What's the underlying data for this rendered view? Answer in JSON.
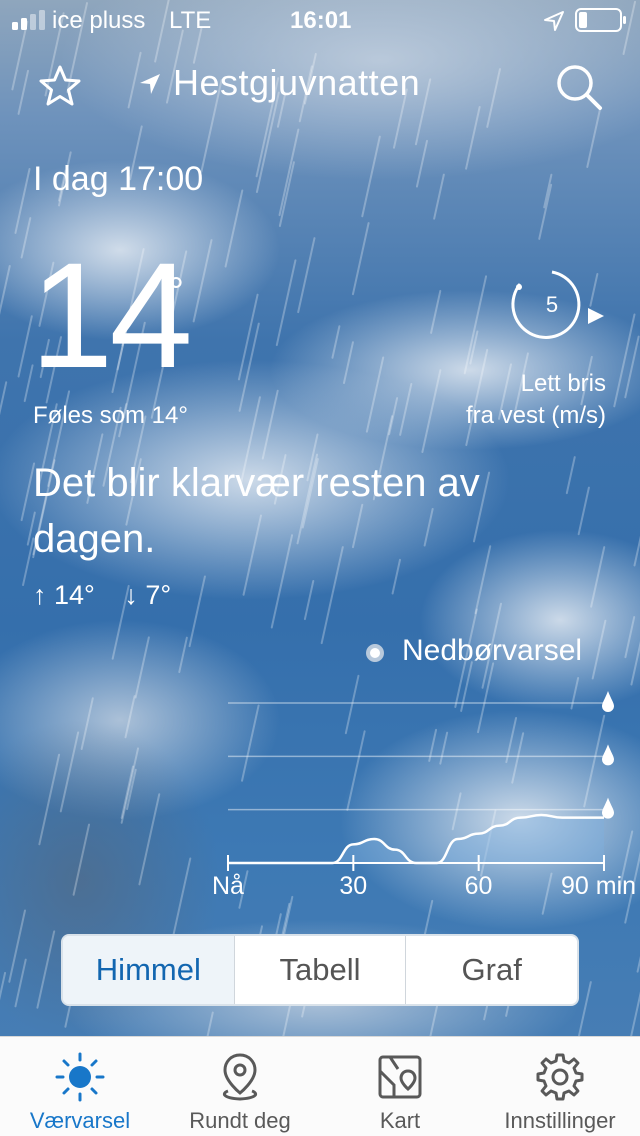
{
  "status_bar": {
    "carrier": "ice pluss",
    "network": "LTE",
    "time": "16:01"
  },
  "header": {
    "location": "Hestgjuvnatten"
  },
  "current": {
    "when": "I dag 17:00",
    "temperature": "14",
    "degree_symbol": "°",
    "feels_like": "Føles som 14°",
    "wind_speed": "5",
    "wind_desc_line1": "Lett bris",
    "wind_desc_line2": "fra vest (m/s)",
    "summary": "Det blir klarvær resten av dagen.",
    "high": "↑ 14°",
    "low": "↓ 7°"
  },
  "precipitation": {
    "title": "Nedbørvarsel",
    "x_labels": [
      "Nå",
      "30",
      "60",
      "90 min"
    ]
  },
  "chart_data": {
    "type": "area",
    "title": "Nedbørvarsel",
    "xlabel": "",
    "ylabel": "",
    "x": [
      0,
      10,
      20,
      25,
      30,
      35,
      40,
      45,
      50,
      55,
      60,
      65,
      70,
      75,
      80,
      85,
      90
    ],
    "values": [
      0,
      0,
      0,
      0,
      0.35,
      0.45,
      0.25,
      0,
      0,
      0.45,
      0.55,
      0.7,
      0.85,
      0.9,
      0.85,
      0.85,
      0.85
    ],
    "xlim": [
      0,
      90
    ],
    "ylim": [
      0,
      3
    ],
    "tick_labels": [
      "Nå",
      "30",
      "60",
      "90 min"
    ],
    "grid": true,
    "legend": "none"
  },
  "segmented": {
    "options": [
      "Himmel",
      "Tabell",
      "Graf"
    ],
    "selected": "Himmel"
  },
  "tabbar": {
    "items": [
      {
        "label": "Værvarsel",
        "icon": "sun-icon"
      },
      {
        "label": "Rundt deg",
        "icon": "map-pin-icon"
      },
      {
        "label": "Kart",
        "icon": "map-icon"
      },
      {
        "label": "Innstillinger",
        "icon": "gear-icon"
      }
    ],
    "active": "Værvarsel"
  },
  "colors": {
    "accent": "#1877c9",
    "sky": "#3f74ad",
    "chart_fill": "#7fb0dd"
  }
}
